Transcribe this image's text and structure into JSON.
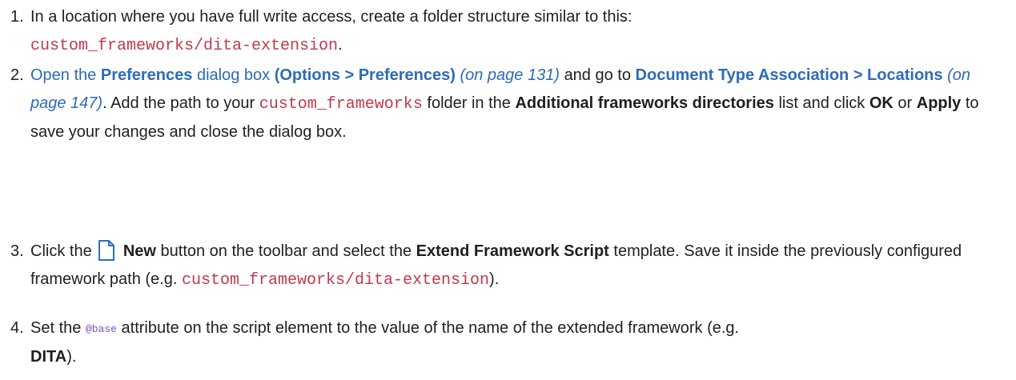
{
  "steps": [
    {
      "number": "1.",
      "text_a": "In a location where you have full write access, create a folder structure similar to this:",
      "code": "custom_frameworks/dita-extension",
      "text_b": "."
    },
    {
      "number": "2.",
      "link_open": "Open the",
      "link_preferences": "Preferences",
      "link_dialog_box": "dialog box",
      "options_path": "(Options > Preferences)",
      "page_ref_1": "(on page 131)",
      "text_goto": "and go to",
      "doc_type_assoc": "Document Type Association > Locations",
      "page_ref_2": "(on page 147)",
      "text_add": ". Add the path to your",
      "code": "custom_frameworks",
      "text_folder": "folder in the",
      "additional_dirs": "Additional frameworks directories",
      "text_list": "list and click",
      "ok": "OK",
      "text_or": "or",
      "apply": "Apply",
      "text_end": "to save your changes and close the dialog box."
    },
    {
      "number": "3.",
      "text_click": "Click the",
      "icon": "new-document-icon",
      "new_label": "New",
      "text_button": "button on the toolbar and select the",
      "template_name": "Extend Framework Script",
      "text_template": "template. Save it inside the previously configured framework path (e.g.",
      "code": "custom_frameworks/dita-extension",
      "text_end": ")."
    },
    {
      "number": "4.",
      "text_set": "Set the",
      "attr": "@base",
      "text_rest": "attribute on the script element to the value of the name of the extended framework (e.g.",
      "dita": "DITA",
      "text_end": ")."
    }
  ],
  "colors": {
    "link": "#2d6bb8",
    "code": "#c0394b",
    "attribute": "#7a4fb8",
    "text": "#1f1f1f"
  }
}
